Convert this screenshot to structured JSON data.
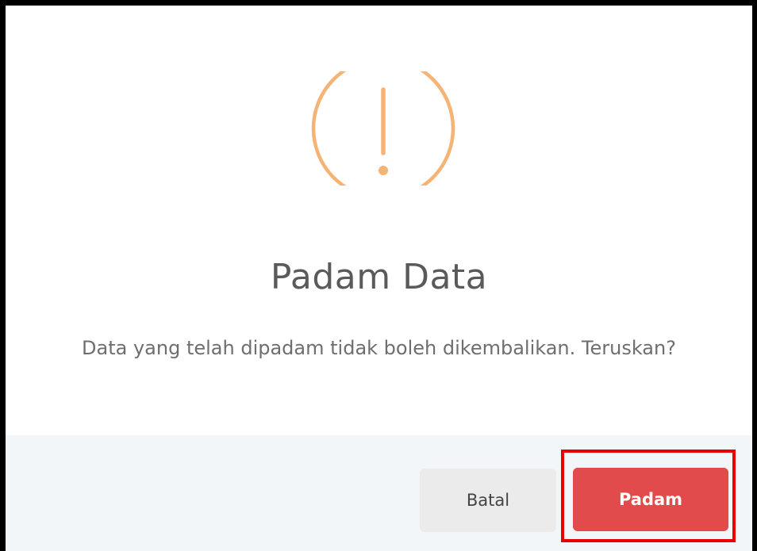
{
  "dialog": {
    "icon": "warning-exclamation-icon",
    "icon_color": "#f5b376",
    "title": "Padam Data",
    "message": "Data yang telah dipadam tidak boleh dikembalikan. Teruskan?"
  },
  "buttons": {
    "cancel_label": "Batal",
    "delete_label": "Padam"
  },
  "colors": {
    "delete_button": "#e24b4b",
    "cancel_button": "#ebebeb",
    "footer_background": "#f3f6f9",
    "highlight": "#e80000"
  }
}
